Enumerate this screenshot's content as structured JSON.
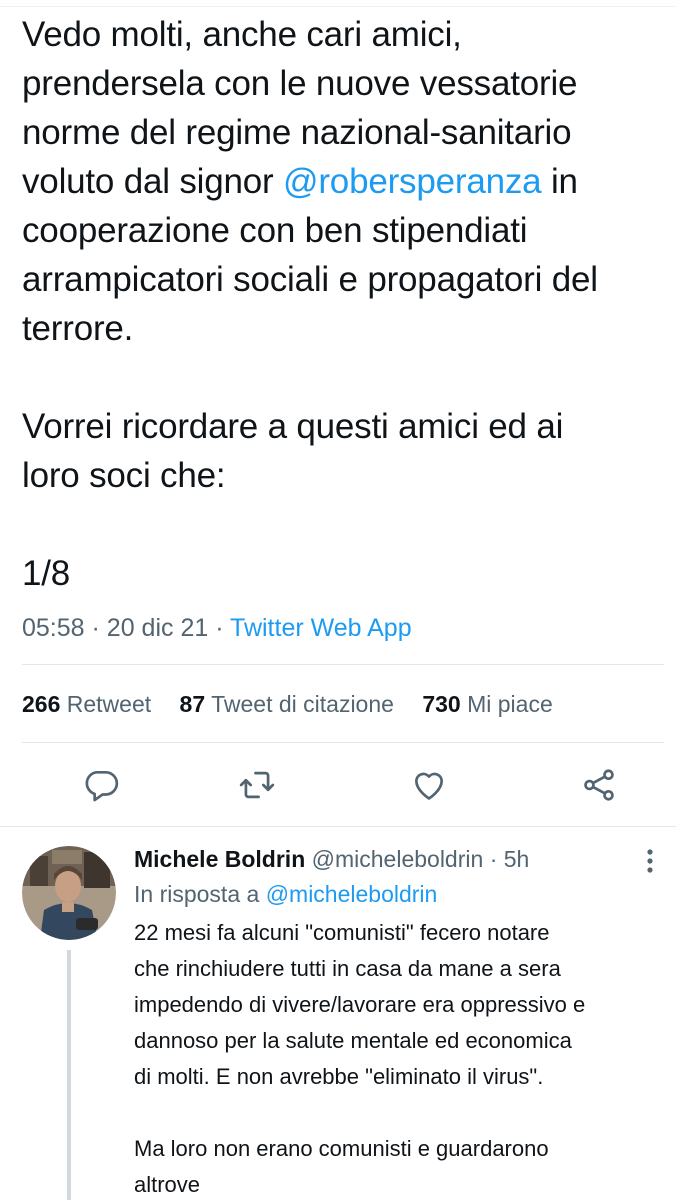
{
  "tweet": {
    "lines": [
      "Vedo molti, anche cari amici,",
      "prendersela con le nuove vessatorie",
      "norme del regime nazional-sanitario",
      "voluto dal signor ",
      "cooperazione con ben stipendiati",
      "arrampicatori sociali e propagatori del",
      "terrore.",
      "Vorrei ricordare a questi amici ed ai",
      "loro soci che:",
      "1/8"
    ],
    "mention": "@robersperanza",
    "mention_suffix": " in",
    "time": "05:58",
    "date": "20 dic 21",
    "separator": "·",
    "source": "Twitter Web App"
  },
  "stats": {
    "retweets": "266",
    "retweets_label": "Retweet",
    "quotes": "87",
    "quotes_label": "Tweet di citazione",
    "likes": "730",
    "likes_label": "Mi piace"
  },
  "actions": {
    "icons": [
      "reply-icon",
      "retweet-icon",
      "like-icon",
      "share-icon"
    ],
    "color": "#536471"
  },
  "reply": {
    "name": "Michele Boldrin",
    "handle": "@micheleboldrin",
    "separator": "·",
    "age": "5h",
    "reply_to_label": "In risposta a",
    "reply_to_handle": "@micheleboldrin",
    "lines": [
      "22 mesi fa alcuni \"comunisti\" fecero notare",
      "che rinchiudere tutti in casa da mane a sera",
      "impedendo di vivere/lavorare era oppressivo e",
      "dannoso per la salute mentale ed economica",
      "di molti. E non avrebbe \"eliminato il virus\".",
      "Ma loro non erano comunisti e guardarono",
      "altrove"
    ]
  },
  "colors": {
    "accent": "#1d9bf0",
    "text": "#0f1419",
    "secondary": "#536471",
    "divider": "#e1e8ed"
  }
}
